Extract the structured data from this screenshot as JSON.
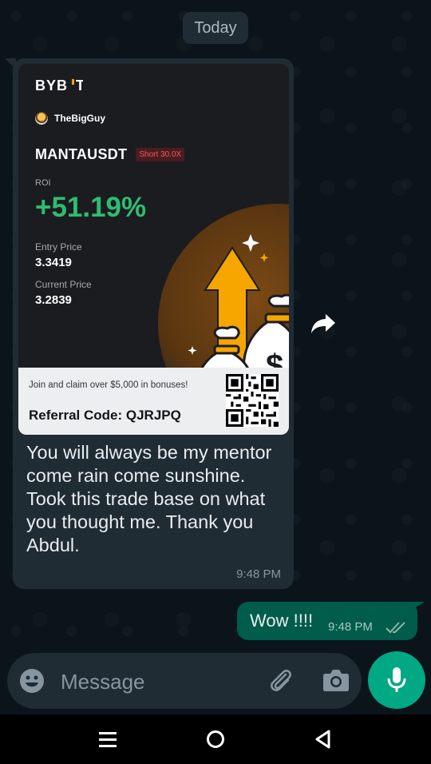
{
  "chat": {
    "date_chip": "Today",
    "incoming": {
      "card": {
        "brand": "BYBIT",
        "username": "TheBigGuy",
        "pair": "MANTAUSDT",
        "position_badge": "Short 30.0X",
        "roi_label": "ROI",
        "roi_value": "+51.19%",
        "entry_price_label": "Entry Price",
        "entry_price_value": "3.3419",
        "current_price_label": "Current Price",
        "current_price_value": "3.2839",
        "promo_text": "Join and claim over $5,000 in bonuses!",
        "referral_code": "Referral Code: QJRJPQ"
      },
      "text": "You will always be my mentor come rain come sunshine.  Took this trade base on what you thought me. Thank you Abdul.",
      "time": "9:48 PM"
    },
    "outgoing": {
      "text": "Wow !!!!",
      "time": "9:48 PM",
      "status": "read"
    }
  },
  "composer": {
    "placeholder": "Message"
  },
  "icons": {
    "emoji": "emoji-icon",
    "attach": "paperclip-icon",
    "camera": "camera-icon",
    "mic": "microphone-icon",
    "forward": "forward-icon"
  },
  "colors": {
    "accent": "#00a884",
    "outgoing_bubble": "#005c4b",
    "incoming_bubble": "#1f2c34",
    "roi_green": "#2ebd71",
    "bybit_orange": "#f7a600"
  }
}
